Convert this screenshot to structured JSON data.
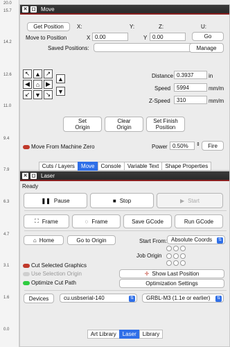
{
  "ruler": {
    "ticks": [
      "20.0",
      "15.7",
      "14.2",
      "12.6",
      "11.0",
      "9.4",
      "7.9",
      "6.3",
      "4.7",
      "3.1",
      "1.6",
      "0.0"
    ]
  },
  "move": {
    "title": "Move",
    "get_position": "Get Position",
    "col_x": "X:",
    "col_y": "Y:",
    "col_z": "Z:",
    "col_u": "U:",
    "move_to_position": "Move to Position",
    "x_label": "X",
    "x_value": "0.00",
    "y_label": "Y",
    "y_value": "0.00",
    "go": "Go",
    "saved_positions": "Saved Positions:",
    "manage": "Manage",
    "distance_label": "Distance",
    "distance_value": "0.3937",
    "distance_unit": "in",
    "speed_label": "Speed",
    "speed_value": "5994",
    "speed_unit": "mm/m",
    "zspeed_label": "Z-Speed",
    "zspeed_value": "310",
    "zspeed_unit": "mm/m",
    "set_origin_1": "Set",
    "set_origin_2": "Origin",
    "clear_origin_1": "Clear",
    "clear_origin_2": "Origin",
    "set_finish_1": "Set Finish",
    "set_finish_2": "Position",
    "move_from_zero": "Move From Machine Zero",
    "power_label": "Power",
    "power_value": "0.50%",
    "fire": "Fire",
    "tabs": [
      "Cuts / Layers",
      "Move",
      "Console",
      "Variable Text",
      "Shape Properties"
    ]
  },
  "laser": {
    "title": "Laser",
    "status": "Ready",
    "pause": "Pause",
    "stop": "Stop",
    "start": "Start",
    "frame1": "Frame",
    "frame2": "Frame",
    "save_gcode": "Save GCode",
    "run_gcode": "Run GCode",
    "home": "Home",
    "go_to_origin": "Go to Origin",
    "start_from_label": "Start From:",
    "start_from_value": "Absolute Coords",
    "job_origin_label": "Job Origin",
    "cut_selected": "Cut Selected Graphics",
    "use_selection_origin": "Use Selection Origin",
    "optimize_cut_path": "Optimize Cut Path",
    "show_last_position": "Show Last Position",
    "optimization_settings": "Optimization Settings",
    "devices": "Devices",
    "port_value": "cu.usbserial-140",
    "device_value": "GRBL-M3 (1.1e or earlier)",
    "tabs": [
      "Art Library",
      "Laser",
      "Library"
    ]
  },
  "colors": {
    "accent": "#2f6fe8",
    "titlebar": "#2a2a2a",
    "toggle_off": "#c0392b",
    "toggle_on": "#2ecc40"
  }
}
